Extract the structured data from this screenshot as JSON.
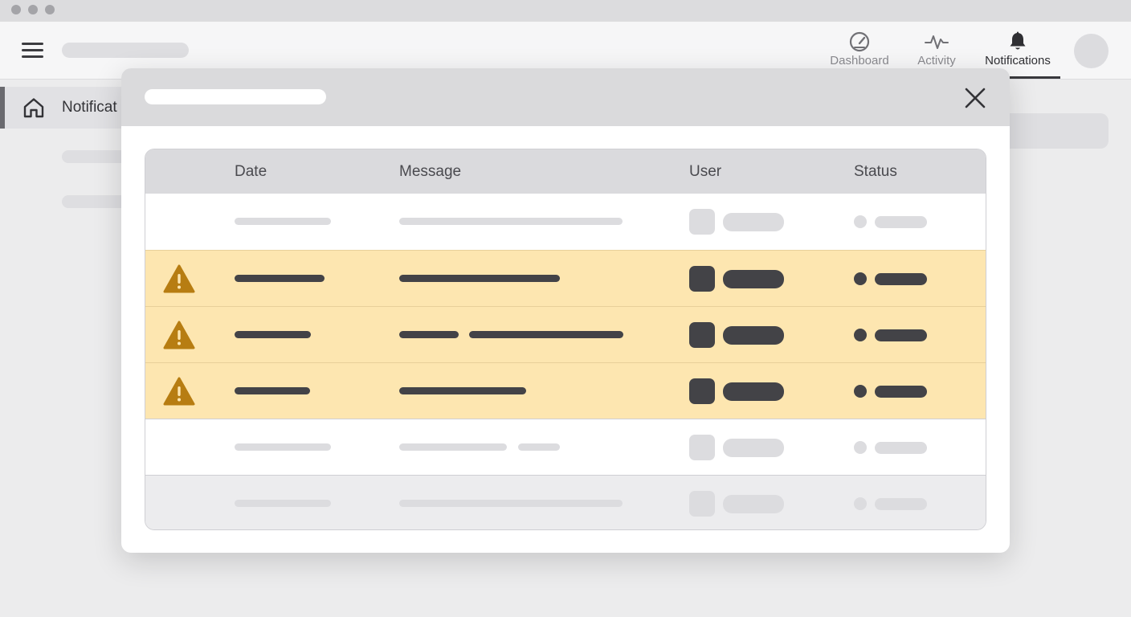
{
  "nav": {
    "items": [
      {
        "label": "Dashboard",
        "icon": "gauge-icon"
      },
      {
        "label": "Activity",
        "icon": "activity-pulse-icon"
      },
      {
        "label": "Notifications",
        "icon": "bell-icon",
        "active": true
      }
    ]
  },
  "sidebar": {
    "active_item": {
      "label": "Notificat",
      "icon": "home-icon"
    }
  },
  "table": {
    "columns": [
      "Date",
      "Message",
      "User",
      "Status"
    ]
  },
  "colors": {
    "warning_row": "#fde6b0",
    "warning_icon": "#b77d12",
    "placeholder_dark": "#434347",
    "placeholder_light": "#dcdcdf"
  }
}
